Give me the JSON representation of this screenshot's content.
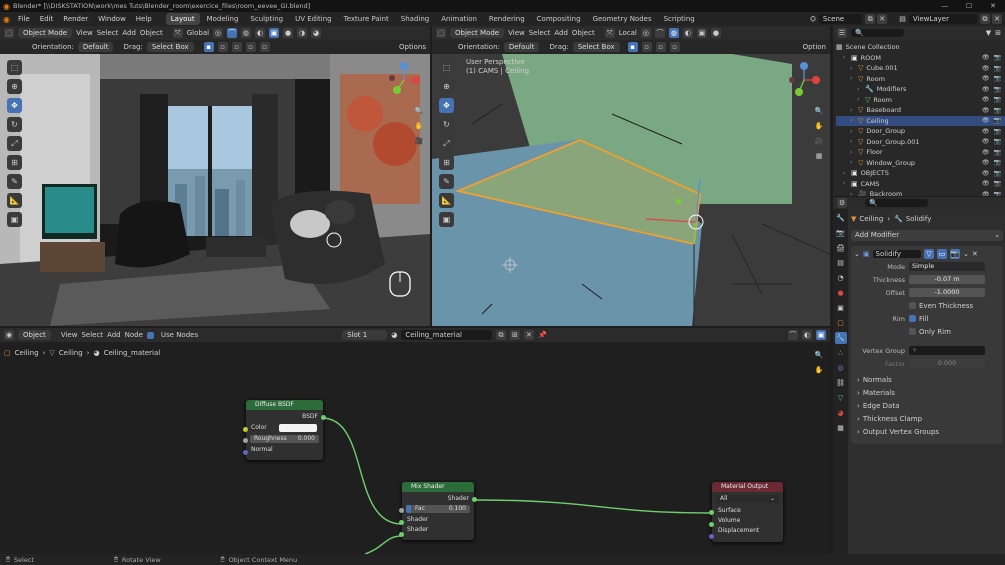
{
  "window_title": "Blender* [\\\\DISKSTATION\\work\\mes Tuts\\Blender_room\\exercice_files\\room_eevee_GI.blend]",
  "menu": [
    "File",
    "Edit",
    "Render",
    "Window",
    "Help"
  ],
  "workspaces": [
    "Layout",
    "Modeling",
    "Sculpting",
    "UV Editing",
    "Texture Paint",
    "Shading",
    "Animation",
    "Rendering",
    "Compositing",
    "Geometry Nodes",
    "Scripting"
  ],
  "active_workspace": "Layout",
  "scene_name": "Scene",
  "view_layer": "ViewLayer",
  "viewport_left": {
    "mode": "Object Mode",
    "menus": [
      "View",
      "Select",
      "Add",
      "Object"
    ],
    "transform": "Global",
    "orientation_label": "Orientation:",
    "orientation_value": "Default",
    "drag_label": "Drag:",
    "drag_value": "Select Box",
    "options": "Options"
  },
  "viewport_right": {
    "mode": "Object Mode",
    "menus": [
      "View",
      "Select",
      "Add",
      "Object"
    ],
    "transform": "Local",
    "orientation_label": "Orientation:",
    "orientation_value": "Default",
    "drag_label": "Drag:",
    "drag_value": "Select Box",
    "options": "Option",
    "perspective": "User Perspective",
    "camera_info": "(1) CAMS | Ceiling"
  },
  "outliner": {
    "root": "Scene Collection",
    "items": [
      {
        "label": "ROOM",
        "indent": 1,
        "icon": "collection-icon",
        "color": "#e8e8e8"
      },
      {
        "label": "Cube.001",
        "indent": 2,
        "icon": "mesh-icon",
        "color": "#e5933b"
      },
      {
        "label": "Room",
        "indent": 2,
        "icon": "mesh-icon",
        "color": "#e5933b"
      },
      {
        "label": "Modifiers",
        "indent": 3,
        "icon": "wrench-icon",
        "color": "#6f9ae0"
      },
      {
        "label": "Room",
        "indent": 3,
        "icon": "mesh-data-icon",
        "color": "#6fcf6f"
      },
      {
        "label": "Baseboard",
        "indent": 2,
        "icon": "mesh-icon",
        "color": "#e5933b"
      },
      {
        "label": "Ceiling",
        "indent": 2,
        "icon": "mesh-icon",
        "color": "#e5933b",
        "selected": true
      },
      {
        "label": "Door_Group",
        "indent": 2,
        "icon": "mesh-icon",
        "color": "#e5933b"
      },
      {
        "label": "Door_Group.001",
        "indent": 2,
        "icon": "mesh-icon",
        "color": "#e5933b"
      },
      {
        "label": "Floor",
        "indent": 2,
        "icon": "mesh-icon",
        "color": "#e5933b"
      },
      {
        "label": "Window_Group",
        "indent": 2,
        "icon": "mesh-icon",
        "color": "#e5933b"
      },
      {
        "label": "OBJECTS",
        "indent": 1,
        "icon": "collection-icon",
        "color": "#e8e8e8"
      },
      {
        "label": "CAMS",
        "indent": 1,
        "icon": "collection-icon",
        "color": "#e8e8e8"
      },
      {
        "label": "Backroom",
        "indent": 2,
        "icon": "camera-icon",
        "color": "#6fcf6f"
      }
    ]
  },
  "properties": {
    "breadcrumb_object": "Ceiling",
    "breadcrumb_modifier": "Solidify",
    "add_modifier": "Add Modifier",
    "modifier_name": "Solidify",
    "mode_label": "Mode",
    "mode_value": "Simple",
    "thickness_label": "Thickness",
    "thickness_value": "-0.07 m",
    "offset_label": "Offset",
    "offset_value": "-1.0000",
    "even_thickness": "Even Thickness",
    "rim_label": "Rim",
    "fill_label": "Fill",
    "only_rim": "Only Rim",
    "vertex_group_label": "Vertex Group",
    "factor_label": "Factor",
    "factor_value": "0.000",
    "panels": [
      "Normals",
      "Materials",
      "Edge Data",
      "Thickness Clamp",
      "Output Vertex Groups"
    ]
  },
  "shader_editor": {
    "editor_type": "Object",
    "menus": [
      "View",
      "Select",
      "Add",
      "Node"
    ],
    "use_nodes": "Use Nodes",
    "slot": "Slot 1",
    "material": "Ceiling_material",
    "breadcrumb": [
      "Ceiling",
      "Ceiling",
      "Ceiling_material"
    ],
    "nodes": {
      "diffuse": {
        "title": "Diffuse BSDF",
        "output": "BSDF",
        "color_label": "Color",
        "roughness_label": "Roughness",
        "roughness_value": "0.000",
        "normal_label": "Normal"
      },
      "mix": {
        "title": "Mix Shader",
        "output": "Shader",
        "fac_label": "Fac",
        "fac_value": "0.100",
        "in1": "Shader",
        "in2": "Shader"
      },
      "output": {
        "title": "Material Output",
        "target": "All",
        "surface": "Surface",
        "volume": "Volume",
        "displacement": "Displacement"
      }
    }
  },
  "status": {
    "select": "Select",
    "rotate": "Rotate View",
    "context": "Object Context Menu"
  },
  "colors": {
    "accent": "#4772b3",
    "selected_row": "#334d80",
    "ceiling_edge": "#f0a030",
    "wall_green": "#7aa882",
    "floor_blue": "#6a94aa"
  }
}
